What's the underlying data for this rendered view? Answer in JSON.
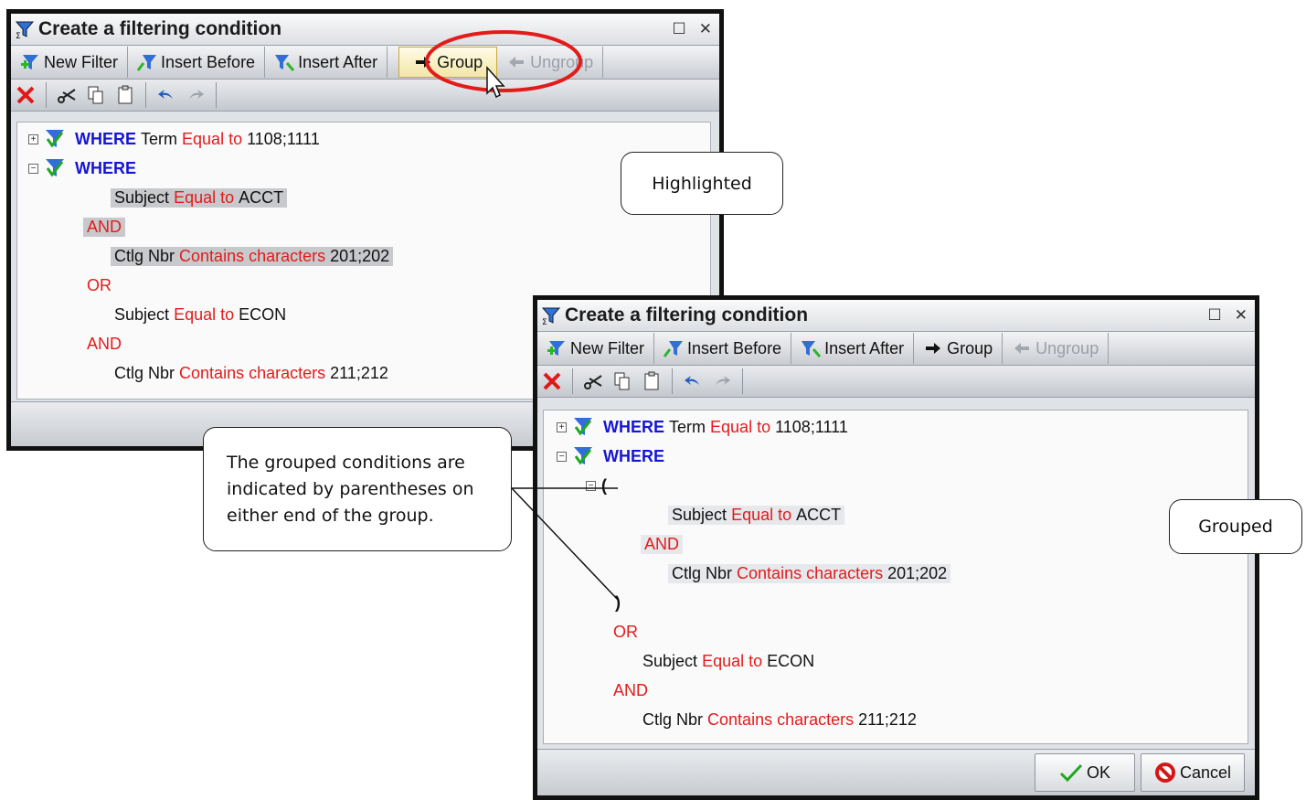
{
  "dialog_title": "Create a filtering condition",
  "toolbar": {
    "new_filter": "New Filter",
    "insert_before": "Insert Before",
    "insert_after": "Insert After",
    "group": "Group",
    "ungroup": "Ungroup"
  },
  "keywords": {
    "where": "WHERE",
    "and": "AND",
    "or": "OR",
    "open_paren": "(",
    "close_paren": ")"
  },
  "conditions": {
    "term": {
      "field": "Term",
      "op": "Equal to",
      "value": "1108;1111"
    },
    "subject_acct": {
      "field": "Subject",
      "op": "Equal to",
      "value": "ACCT"
    },
    "ctlg_201": {
      "field": "Ctlg Nbr",
      "op": "Contains characters",
      "value": "201;202"
    },
    "subject_econ": {
      "field": "Subject",
      "op": "Equal to",
      "value": "ECON"
    },
    "ctlg_211": {
      "field": "Ctlg Nbr",
      "op": "Contains characters",
      "value": "211;212"
    }
  },
  "buttons": {
    "ok": "OK",
    "cancel": "Cancel"
  },
  "callouts": {
    "highlighted": "Highlighted",
    "grouped": "Grouped",
    "note_line1": "The grouped conditions are",
    "note_line2": "indicated by parentheses on",
    "note_line3": "either end of the group."
  },
  "colors": {
    "where_blue": "#1515d6",
    "operator_red": "#e31b1b",
    "highlight_ellipse": "#e31b1b"
  }
}
